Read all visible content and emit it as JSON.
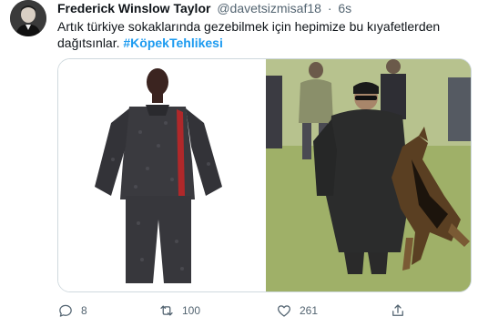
{
  "tweet": {
    "author": {
      "name": "Frederick Winslow Taylor",
      "handle": "@davetsizmisaf18",
      "separator": "·",
      "time": "6s"
    },
    "text_main": "Artık türkiye sokaklarında gezebilmek için hepimize bu kıyafetlerden dağıtsınlar.",
    "hashtag": "#KöpekTehlikesi",
    "actions": {
      "reply_count": "8",
      "retweet_count": "100",
      "like_count": "261"
    }
  },
  "colors": {
    "link": "#1d9bf0",
    "secondary_text": "#536471",
    "border": "#cfd9de"
  },
  "icons": [
    "reply-icon",
    "retweet-icon",
    "like-icon",
    "share-icon"
  ]
}
